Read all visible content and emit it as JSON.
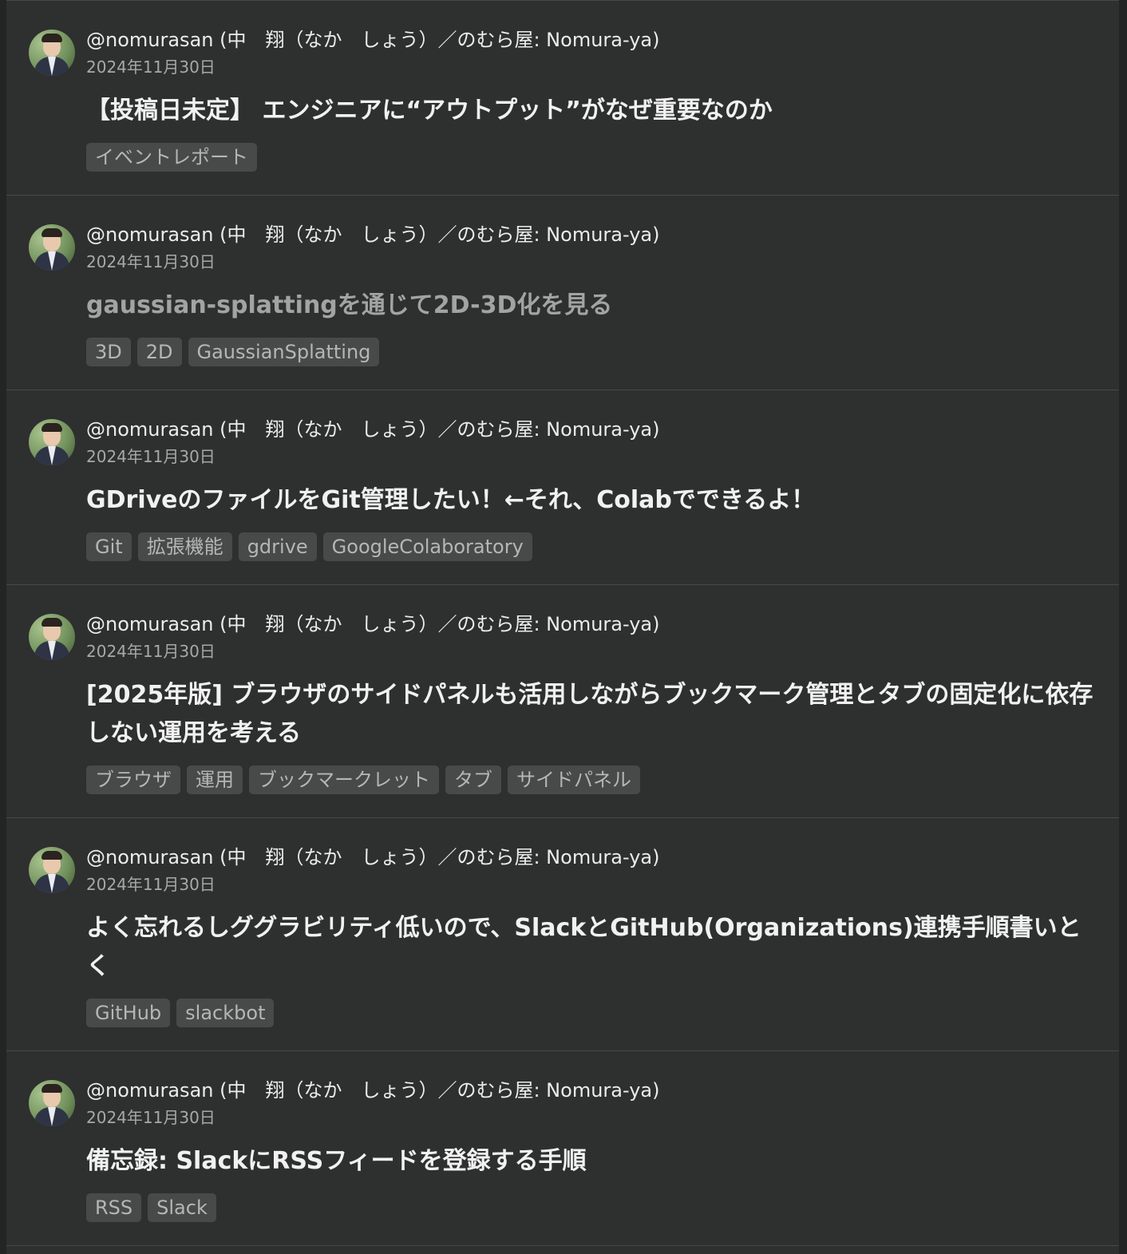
{
  "posts": [
    {
      "author": "@nomurasan (中　翔（なか　しょう）／のむら屋: Nomura-ya)",
      "date": "2024年11月30日",
      "title": "【投稿日未定】 エンジニアに“アウトプット”がなぜ重要なのか",
      "title_state": "unread",
      "tags": [
        "イベントレポート"
      ]
    },
    {
      "author": "@nomurasan (中　翔（なか　しょう）／のむら屋: Nomura-ya)",
      "date": "2024年11月30日",
      "title": "gaussian-splattingを通じて2D-3D化を見る",
      "title_state": "visited",
      "tags": [
        "3D",
        "2D",
        "GaussianSplatting"
      ]
    },
    {
      "author": "@nomurasan (中　翔（なか　しょう）／のむら屋: Nomura-ya)",
      "date": "2024年11月30日",
      "title": "GDriveのファイルをGit管理したい！←それ、Colabでできるよ！",
      "title_state": "unread",
      "tags": [
        "Git",
        "拡張機能",
        "gdrive",
        "GoogleColaboratory"
      ]
    },
    {
      "author": "@nomurasan (中　翔（なか　しょう）／のむら屋: Nomura-ya)",
      "date": "2024年11月30日",
      "title": "[2025年版] ブラウザのサイドパネルも活用しながらブックマーク管理とタブの固定化に依存しない運用を考える",
      "title_state": "unread",
      "tags": [
        "ブラウザ",
        "運用",
        "ブックマークレット",
        "タブ",
        "サイドパネル"
      ]
    },
    {
      "author": "@nomurasan (中　翔（なか　しょう）／のむら屋: Nomura-ya)",
      "date": "2024年11月30日",
      "title": "よく忘れるしググラビリティ低いので、SlackとGitHub(Organizations)連携手順書いとく",
      "title_state": "unread",
      "tags": [
        "GitHub",
        "slackbot"
      ]
    },
    {
      "author": "@nomurasan (中　翔（なか　しょう）／のむら屋: Nomura-ya)",
      "date": "2024年11月30日",
      "title": "備忘録: SlackにRSSフィードを登録する手順",
      "title_state": "unread",
      "tags": [
        "RSS",
        "Slack"
      ]
    }
  ],
  "colors": {
    "background": "#2e2f2f",
    "divider": "#474848",
    "title": "#f1f1f1",
    "title_visited": "#a3a3a3",
    "tag_background": "#484949",
    "tag_text": "#b6b6b6",
    "date": "#a8a8a8"
  }
}
